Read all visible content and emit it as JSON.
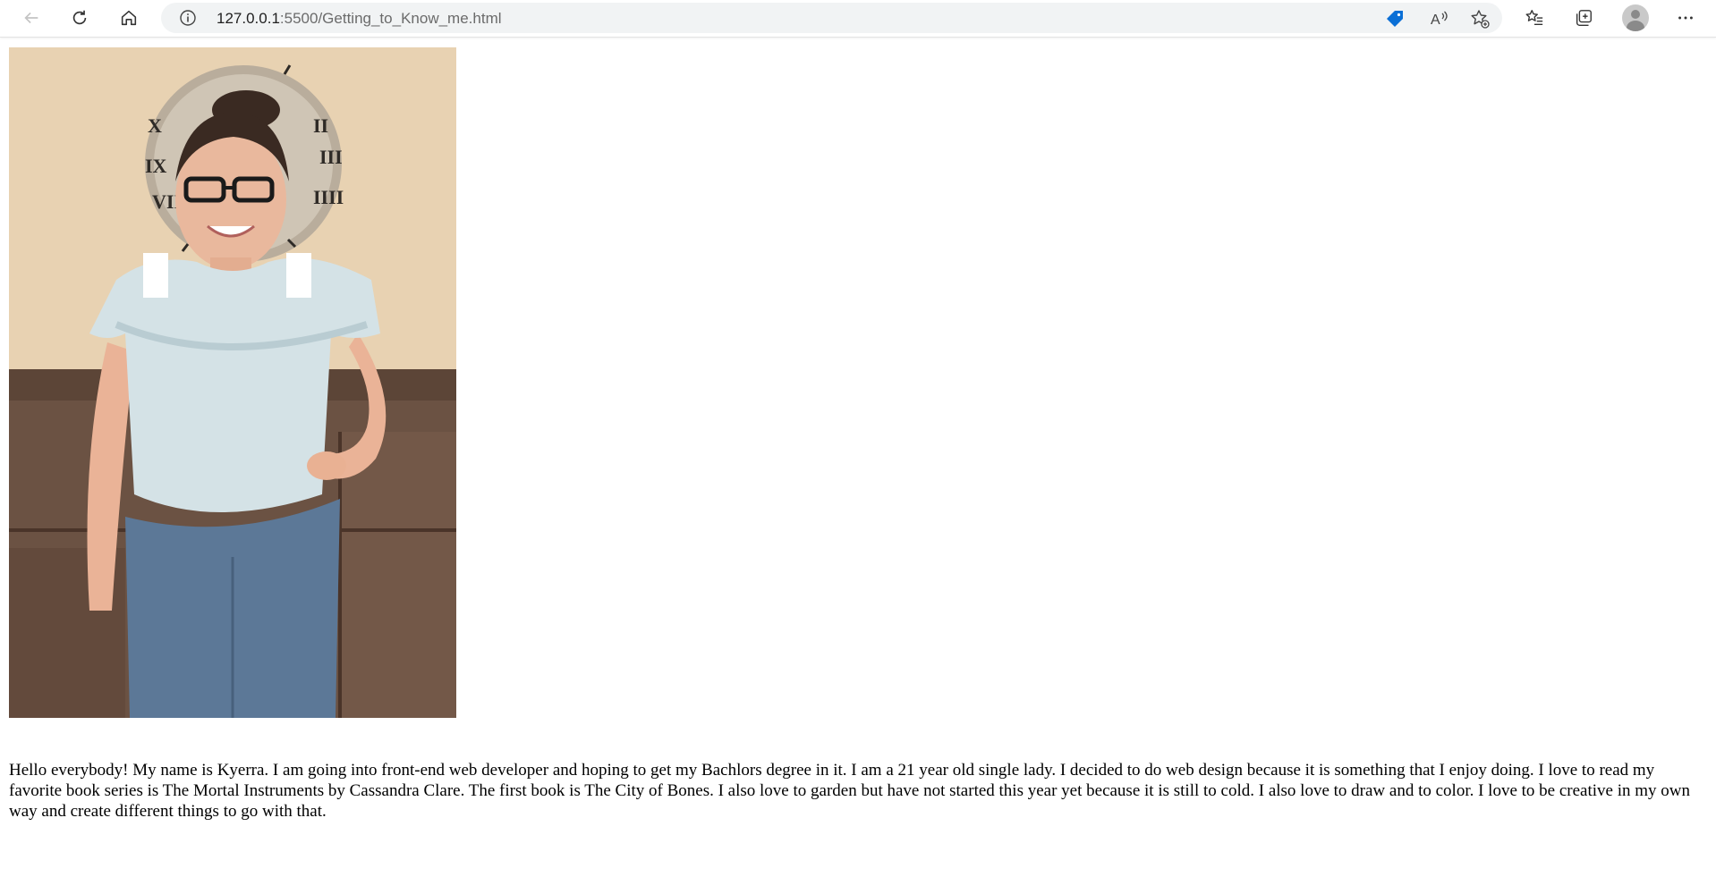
{
  "browser": {
    "url_host": "127.0.0.1",
    "url_rest": ":5500/Getting_to_Know_me.html",
    "icons": [
      "back-icon",
      "refresh-icon",
      "home-icon",
      "info-icon",
      "tag-icon",
      "read-aloud-icon",
      "add-favorite-icon",
      "favorites-icon",
      "collections-icon",
      "profile-icon",
      "more-icon"
    ]
  },
  "photo": {
    "alt": "Photo of Kyerra"
  },
  "content": {
    "intro": "Hello everybody! My name is Kyerra. I am going into front-end web developer and hoping to get my Bachlors degree in it. I am a 21 year old single lady. I decided to do web design because it is something that I enjoy doing. I love to read my favorite book series is The Mortal Instruments by Cassandra Clare. The first book is The City of Bones. I also love to garden but have not started this year yet because it is still to cold. I also love to draw and to color. I love to be creative in my own way and create different things to go with that."
  },
  "colors": {
    "accent_tag": "#0a6fd6",
    "toolbar_bg": "#ffffff",
    "address_bg": "#f1f3f4"
  }
}
